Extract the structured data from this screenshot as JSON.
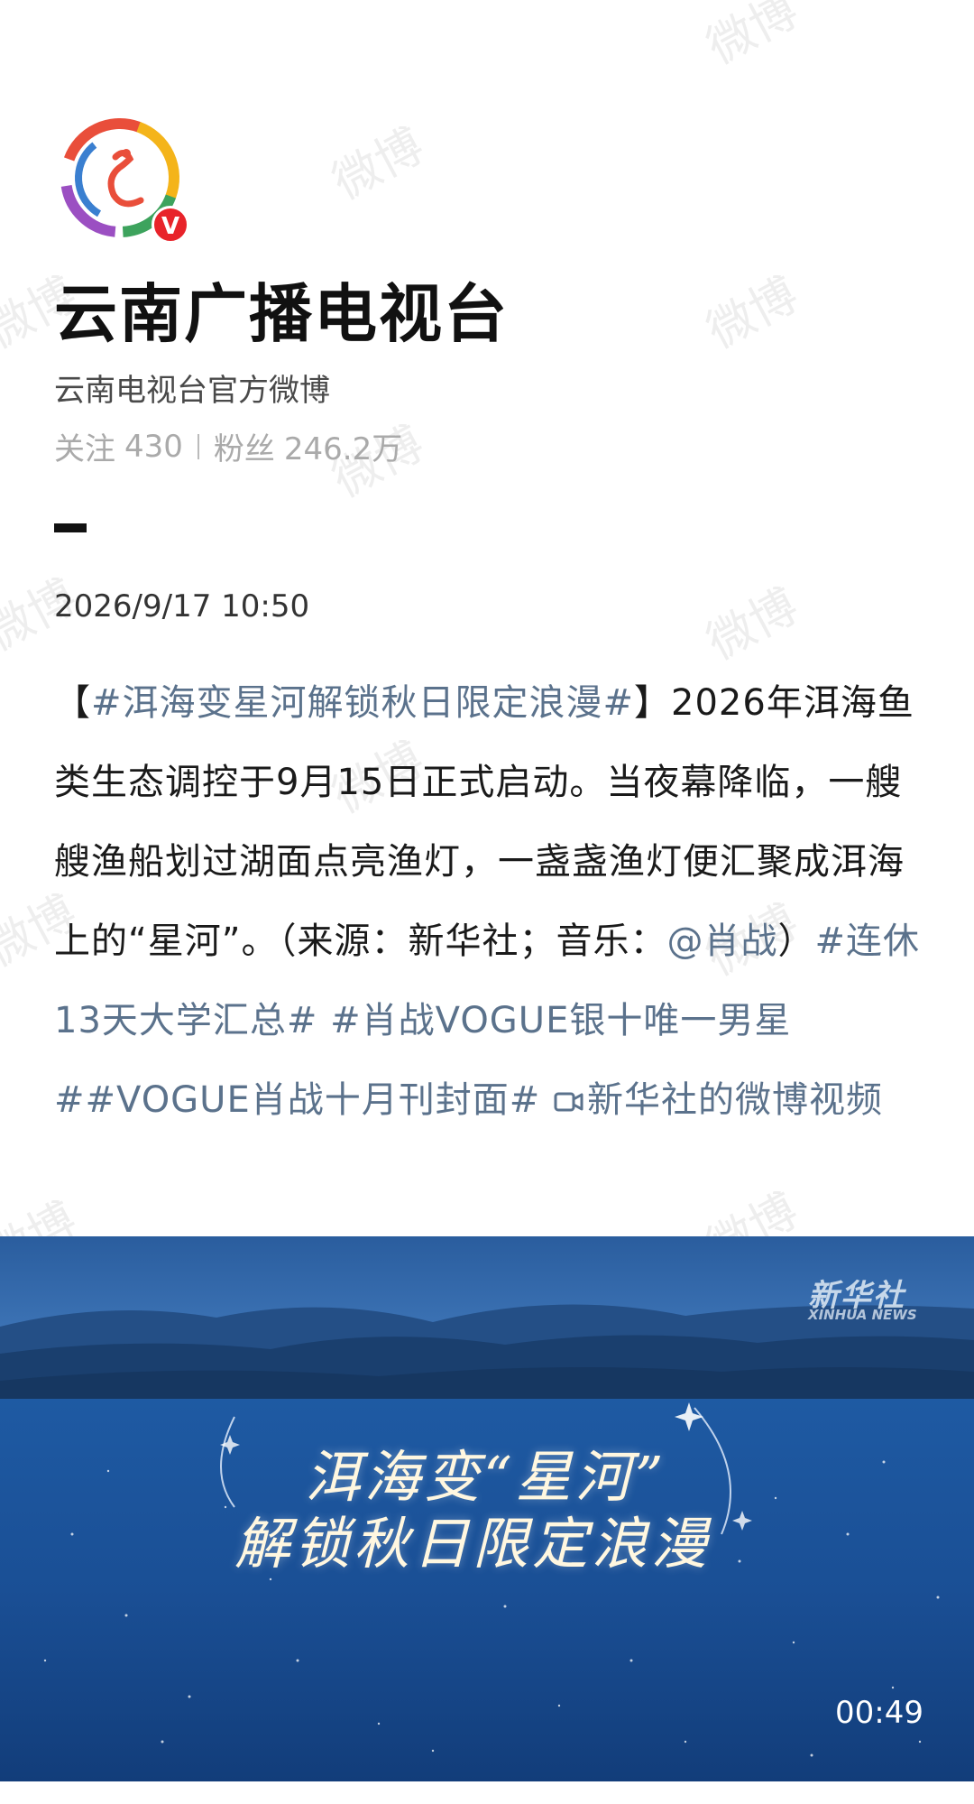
{
  "watermark_text": "微博",
  "account": {
    "name": "云南广播电视台",
    "description": "云南电视台官方微博",
    "verified_badge": "V",
    "following_label": "关注",
    "following_count": "430",
    "followers_label": "粉丝",
    "followers_count": "246.2万"
  },
  "post": {
    "timestamp": "2026/9/17 10:50",
    "bracket_open": "【",
    "topic_main": "#洱海变星河解锁秋日限定浪漫#",
    "bracket_close": "】",
    "body": "2026年洱海鱼类生态调控于9月15日正式启动。当夜幕降临，一艘艘渔船划过湖面点亮渔灯，一盏盏渔灯便汇聚成洱海上的“星河”。（来源：新华社；音乐：",
    "mention": "@肖战",
    "body_after_mention": "）",
    "topics": [
      "#连休13天大学汇总#",
      "#肖战VOGUE银十唯一男星#",
      "#VOGUE肖战十月刊封面#"
    ],
    "video_link_label": "新华社的微博视频"
  },
  "video": {
    "source_logo": "新华社",
    "source_logo_sub": "XINHUA NEWS",
    "title_line1": "洱海变“星河”",
    "title_line2": "解锁秋日限定浪漫",
    "duration": "00:49"
  },
  "icons": {
    "avatar": "peacock-ring-logo",
    "verified": "verified-v-badge",
    "video_link": "video-camera-icon"
  },
  "colors": {
    "link": "#5b728c",
    "verified_badge": "#e8232a",
    "video_background": "#1f4f8f"
  }
}
